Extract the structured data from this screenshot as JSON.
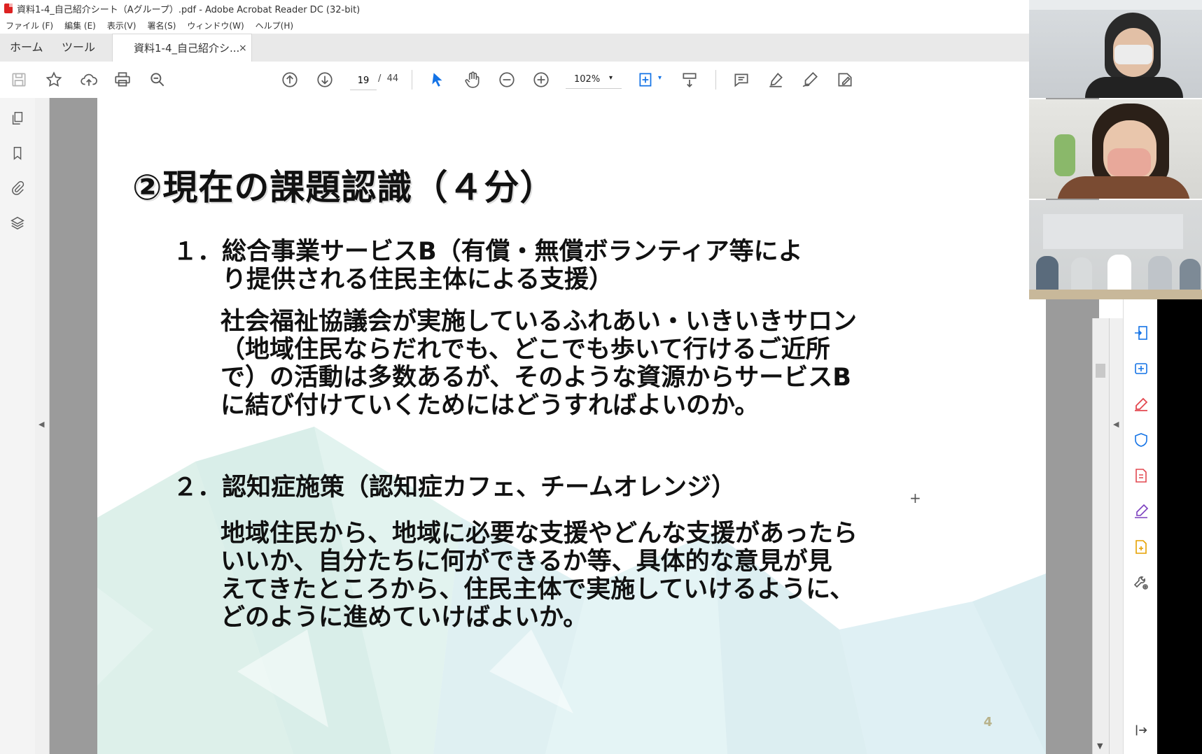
{
  "window": {
    "title": "資料1-4_自己紹介シート（Aグループ）.pdf - Adobe Acrobat Reader DC (32-bit)"
  },
  "menu": {
    "items": [
      "ファイル (F)",
      "編集 (E)",
      "表示(V)",
      "署名(S)",
      "ウィンドウ(W)",
      "ヘルプ(H)"
    ]
  },
  "tabs": {
    "home": "ホーム",
    "tools": "ツール",
    "document": "資料1-4_自己紹介シ...",
    "close": "×"
  },
  "toolbar": {
    "current_page": "19",
    "page_separator": "/",
    "total_pages": "44",
    "zoom": "102%",
    "zoom_arrow": "▾"
  },
  "icons": {
    "left_rail": [
      "pages-icon",
      "bookmark-icon",
      "attachment-icon",
      "layers-icon"
    ],
    "right_rail": [
      "export-pdf-icon",
      "create-pdf-icon",
      "edit-pdf-icon",
      "protect-icon",
      "compress-pdf-icon",
      "fill-sign-icon",
      "send-review-icon",
      "more-tools-icon",
      "expand-panel-icon"
    ]
  },
  "document": {
    "slide_title": "②現在の課題認識（４分）",
    "items": [
      {
        "heading": "１．総合事業サービスB（有償・無償ボランティア等によ\n　　り提供される住民主体による支援）",
        "body": "社会福祉協議会が実施しているふれあい・いきいきサロン\n（地域住民ならだれでも、どこでも歩いて行けるご近所\nで）の活動は多数あるが、そのような資源からサービスB\nに結び付けていくためにはどうすればよいのか。"
      },
      {
        "heading": "２．認知症施策（認知症カフェ、チームオレンジ）",
        "body": "地域住民から、地域に必要な支援やどんな支援があったら\nいいか、自分たちに何ができるか等、具体的な意見が見\nえてきたところから、住民主体で実施していけるように、\nどのように進めていけばよいか。"
      }
    ],
    "page_label": "4"
  },
  "colors": {
    "accent_blue": "#1a73e8",
    "pdf_red": "#d22222",
    "rail_icon_blue": "#1473e6",
    "rail_icon_red": "#e34850",
    "rail_icon_purple": "#7b3fbf",
    "rail_icon_yellow": "#e6a100",
    "toolbar_gray": "#5c5c5c",
    "doc_bg": "#9b9b9b"
  }
}
